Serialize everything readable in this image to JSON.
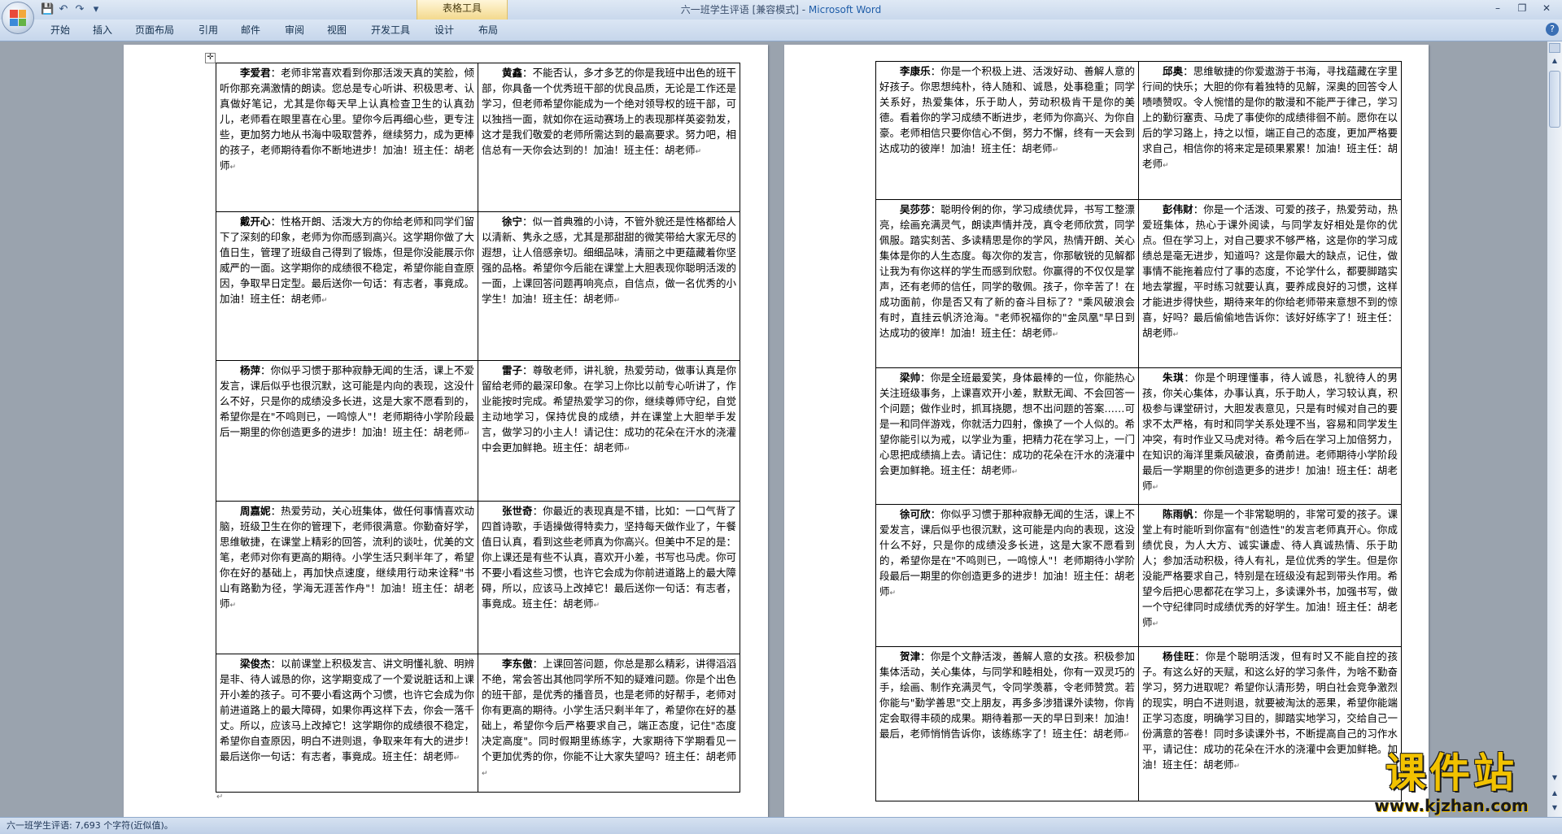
{
  "window": {
    "title": "六一班学生评语 [兼容模式] - ",
    "app_name": "Microsoft Word",
    "context_group": "表格工具"
  },
  "quick_access": [
    {
      "name": "save-icon",
      "glyph": "💾"
    },
    {
      "name": "undo-icon",
      "glyph": "↶"
    },
    {
      "name": "redo-icon",
      "glyph": "↷"
    },
    {
      "name": "customize-qat-icon",
      "glyph": "▾"
    }
  ],
  "window_controls": {
    "minimize": "–",
    "restore": "❐",
    "close": "✕"
  },
  "ribbon_tabs": [
    "开始",
    "插入",
    "页面布局",
    "引用",
    "邮件",
    "审阅",
    "视图",
    "开发工具",
    "设计",
    "布局"
  ],
  "help_glyph": "?",
  "pages": {
    "left": {
      "rows": [
        [
          {
            "name": "李爱君",
            "text": "：老师非常喜欢看到你那活泼天真的笑脸，倾听你那充满激情的朗读。您总是专心听讲、积极思考、认真做好笔记，尤其是你每天早上认真检查卫生的认真劲儿，老师看在眼里喜在心里。望你今后再细心些，更专注些，更加努力地从书海中吸取营养，继续努力，成为更棒的孩子，老师期待看你不断地进步！加油！班主任：胡老师"
          },
          {
            "name": "黄鑫",
            "text": "：不能否认，多才多艺的你是我班中出色的班干部，你具备一个优秀班干部的优良品质，无论是工作还是学习，但老师希望你能成为一个绝对领导权的班干部，可以独挡一面，就如你在运动赛场上的表现那样英姿勃发，这才是我们敬爱的老师所需达到的最高要求。努力吧，相信总有一天你会达到的！加油！班主任：胡老师"
          }
        ],
        [
          {
            "name": "戴开心",
            "text": "：性格开朗、活泼大方的你给老师和同学们留下了深刻的印象，老师为你而感到高兴。这学期你做了大值日生，管理了班级自己得到了锻炼，但是你没能展示你威严的一面。这学期你的成绩很不稳定，希望你能自查原因，争取早日定型。最后送你一句话：有志者，事竟成。加油！班主任：胡老师"
          },
          {
            "name": "徐宁",
            "text": "：似一首典雅的小诗，不管外貌还是性格都给人以清新、隽永之感，尤其是那甜甜的微笑带给大家无尽的遐想，让人倍感亲切。细细品味，清丽之中更蕴藏着你坚强的品格。希望你今后能在课堂上大胆表现你聪明活泼的一面，上课回答问题再响亮点，自信点，做一名优秀的小学生！加油！班主任：胡老师"
          }
        ],
        [
          {
            "name": "杨萍",
            "text": "：你似乎习惯于那种寂静无闻的生活，课上不爱发言，课后似乎也很沉默，这可能是内向的表现，这没什么不好，只是你的成绩没多长进，这是大家不愿看到的，希望你是在\"不鸣则已，一鸣惊人\"！老师期待小学阶段最后一期里的你创造更多的进步！加油！班主任：胡老师"
          },
          {
            "name": "雷子",
            "text": "：尊敬老师，讲礼貌，热爱劳动，做事认真是你留给老师的最深印象。在学习上你比以前专心听讲了，作业能按时完成。希望热爱学习的你，继续尊师守纪，自觉主动地学习，保持优良的成绩，并在课堂上大胆举手发言，做学习的小主人！请记住：成功的花朵在汗水的浇灌中会更加鲜艳。班主任：胡老师"
          }
        ],
        [
          {
            "name": "周嘉妮",
            "text": "：热爱劳动，关心班集体，做任何事情喜欢动脑，班级卫生在你的管理下，老师很满意。你勤奋好学，思维敏捷，在课堂上精彩的回答，流利的谈吐，优美的文笔，老师对你有更高的期待。小学生活只剩半年了，希望你在好的基础上，再加快点速度，继续用行动来诠释\"书山有路勤为径，学海无涯苦作舟\"！加油！班主任：胡老师"
          },
          {
            "name": "张世奇",
            "text": "：你最近的表现真是不错，比如：一口气背了四首诗歌，手语操做得特卖力，坚持每天做作业了，午餐值日认真，看到这些老师真为你高兴。但美中不足的是：你上课还是有些不认真，喜欢开小差，书写也马虎。你可不要小看这些习惯，也许它会成为你前进道路上的最大障碍，所以，应该马上改掉它！最后送你一句话：有志者，事竟成。班主任：胡老师"
          }
        ],
        [
          {
            "name": "梁俊杰",
            "text": "：以前课堂上积极发言、讲文明懂礼貌、明辨是非、待人诚恳的你，这学期变成了一个爱说脏话和上课开小差的孩子。可不要小看这两个习惯，也许它会成为你前进道路上的最大障碍，如果你再这样下去，你会一落千丈。所以，应该马上改掉它！这学期你的成绩很不稳定，希望你自查原因，明白不进则退，争取来年有大的进步！最后送你一句话：有志者，事竟成。班主任：胡老师"
          },
          {
            "name": "李东傲",
            "text": "：上课回答问题，你总是那么精彩，讲得滔滔不绝，常会答出其他同学所不知的疑难问题。你是个出色的班干部，是优秀的播音员，也是老师的好帮手，老师对你有更高的期待。小学生活只剩半年了，希望你在好的基础上，希望你今后严格要求自己，端正态度，记住\"态度决定高度\"。同时假期里练练字，大家期待下学期看见一个更加优秀的你，你能不让大家失望吗？班主任：胡老师"
          }
        ]
      ]
    },
    "right": {
      "rows": [
        [
          {
            "name": "李康乐",
            "text": "：你是一个积极上进、活泼好动、善解人意的好孩子。你思想纯朴，待人随和、诚恳，处事稳重；同学关系好，热爱集体，乐于助人，劳动积极肯干是你的美德。看着你的学习成绩不断进步，老师为你高兴、为你自豪。老师相信只要你信心不倒，努力不懈，终有一天会到达成功的彼岸！加油！班主任：胡老师"
          },
          {
            "name": "邱奥",
            "text": "：思维敏捷的你爱遨游于书海，寻找蕴藏在字里行间的快乐；大胆的你有着独特的见解，深奥的回答令人啧啧赞叹。令人惋惜的是你的散漫和不能严于律己，学习上的勤衍塞责、马虎了事使你的成绩徘徊不前。愿你在以后的学习路上，持之以恒，端正自己的态度，更加严格要求自己，相信你的将来定是硕果累累！加油！班主任：胡老师"
          }
        ],
        [
          {
            "name": "吴莎莎",
            "text": "：聪明伶俐的你，学习成绩优异，书写工整漂亮，绘画充满灵气，朗读声情并茂，真令老师欣赏，同学佩服。踏实刻苦、多读精思是你的学风，热情开朗、关心集体是你的人生态度。每次你的发言，你那敏锐的见解都让我为有你这样的学生而感到欣慰。你赢得的不仅仅是掌声，还有老师的信任，同学的敬佩。孩子，你辛苦了！在成功面前，你是否又有了新的奋斗目标了？\"乘风破浪会有时，直挂云帆济沧海。\"老师祝福你的\"金凤凰\"早日到达成功的彼岸！加油！班主任：胡老师"
          },
          {
            "name": "彭伟财",
            "text": "：你是一个活泼、可爱的孩子，热爱劳动，热爱班集体，热心于课外阅读，与同学友好相处是你的优点。但在学习上，对自己要求不够严格，这是你的学习成绩总是毫无进步，知道吗？这是你最大的缺点，记住，做事情不能拖着应付了事的态度，不论学什么，都要脚踏实地去掌握，平时练习就要认真，要养成良好的习惯，这样才能进步得快些，期待来年的你给老师带来意想不到的惊喜，好吗？最后偷偷地告诉你：该好好练字了！班主任：胡老师"
          }
        ],
        [
          {
            "name": "梁帅",
            "text": "：你是全班最爱笑，身体最棒的一位，你能热心关注班级事务，上课喜欢开小差，默默无闻、不会回答一个问题；做作业时，抓耳挠腮，想不出问题的答案……可是一和同伴游戏，你就活力四射，像换了一个人似的。希望你能引以为戒，以学业为重，把精力花在学习上，一门心思把成绩搞上去。请记住：成功的花朵在汗水的浇灌中会更加鲜艳。班主任：胡老师"
          },
          {
            "name": "朱琪",
            "text": "：你是个明理懂事，待人诚恳，礼貌待人的男孩，你关心集体，办事认真，乐于助人，学习较认真，积极参与课堂研讨，大胆发表意见，只是有时候对自己的要求不太严格，有时和同学关系处理不当，容易和同学发生冲突，有时作业又马虎对待。希今后在学习上加倍努力，在知识的海洋里乘风破浪，奋勇前进。老师期待小学阶段最后一学期里的你创造更多的进步！加油！班主任：胡老师"
          }
        ],
        [
          {
            "name": "徐可欣",
            "text": "：你似乎习惯于那种寂静无闻的生活，课上不爱发言，课后似乎也很沉默，这可能是内向的表现，这没什么不好，只是你的成绩没多长进，这是大家不愿看到的，希望你是在\"不鸣则已，一鸣惊人\"！老师期待小学阶段最后一期里的你创造更多的进步！加油！班主任：胡老师"
          },
          {
            "name": "陈雨帆",
            "text": "：你是一个非常聪明的，非常可爱的孩子。课堂上有时能听到你富有\"创造性\"的发言老师真开心。你成绩优良，为人大方、诚实谦虚、待人真诚热情、乐于助人；参加活动积极，待人有礼，是位优秀的学生。但是你没能严格要求自己，特别是在班级没有起到带头作用。希望今后把心思都花在学习上，多读课外书，加强书写，做一个守纪律同时成绩优秀的好学生。加油！班主任：胡老师"
          }
        ],
        [
          {
            "name": "贺津",
            "text": "：你是个文静活泼，善解人意的女孩。积极参加集体活动，关心集体，与同学和睦相处，你有一双灵巧的手，绘画、制作充满灵气，令同学羡慕，令老师赞赏。若你能与\"勤学善思\"交上朋友，再多多涉猎课外读物，你肯定会取得丰硕的成果。期待着那一天的早日到来！加油！最后，老师悄悄告诉你，该练练字了！班主任：胡老师"
          },
          {
            "name": "杨佳旺",
            "text": "：你是个聪明活泼，但有时又不能自控的孩子。有这么好的天赋，和这么好的学习条件，为啥不勤奋学习，努力进取呢？希望你认清形势，明白社会竞争激烈的现实，明白不进则退，就要被淘汰的恶果，希望你能端正学习态度，明确学习目的，脚踏实地学习，交给自己一份满意的答卷！同时多读课外书，不断提高自己的习作水平，请记住：成功的花朵在汗水的浇灌中会更加鲜艳。加油！班主任：胡老师"
          }
        ]
      ]
    }
  },
  "status_bar": {
    "text": "六一班学生评语: 7,693 个字符(近似值)。"
  },
  "watermark": {
    "main": "课件站",
    "sub": "www.kjzhan.com"
  },
  "colors": {
    "ribbon": "#c6d6eb",
    "workspace": "#9aa3ae",
    "brand": "#1f5da8",
    "watermark_gold": "#f2c200"
  }
}
